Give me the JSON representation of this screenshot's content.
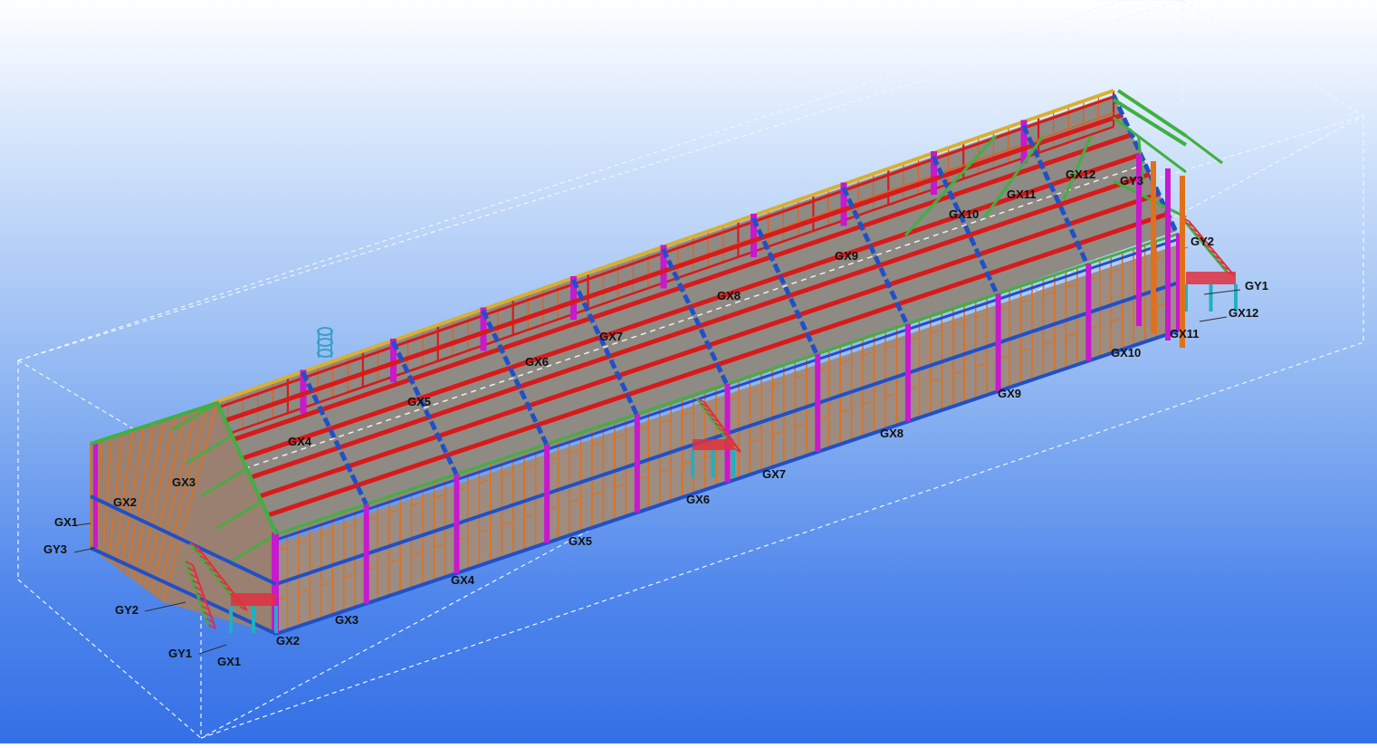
{
  "view": {
    "background_top": "#ffffff",
    "background_bottom": "#3470e6",
    "bounding_box_color": "#eef6ff"
  },
  "colors": {
    "column": "#e0701c",
    "roof_rafter": "#d81a1a",
    "purlin": "#e06020",
    "brace": "#c818d0",
    "edge_beam": "#2050c8",
    "roof_panel": "#8e8a84",
    "eave_strut": "#d8b030",
    "end_frame": "#40b040",
    "stair": "#e03040",
    "footing": "#20b0c0",
    "ridge_line": "#f0f0f0"
  },
  "gridlines": {
    "x_labels": [
      "GX1",
      "GX2",
      "GX3",
      "GX4",
      "GX5",
      "GX6",
      "GX7",
      "GX8",
      "GX9",
      "GX10",
      "GX11",
      "GX12"
    ],
    "y_labels": [
      "GY1",
      "GY2",
      "GY3"
    ]
  },
  "labels": {
    "front_gx": [
      "GX1",
      "GX2",
      "GX3",
      "GX4",
      "GX5",
      "GX6",
      "GX7",
      "GX8",
      "GX9",
      "GX10",
      "GX11"
    ],
    "roof_gx": [
      "GX3",
      "GX4",
      "GX5",
      "GX6",
      "GX7",
      "GX8",
      "GX9",
      "GX10",
      "GX11",
      "GX12"
    ],
    "left_end": [
      "GX1",
      "GX2",
      "GY3",
      "GY2",
      "GY1"
    ],
    "right_end": [
      "GY3",
      "GY2",
      "GY1",
      "GX12"
    ]
  }
}
